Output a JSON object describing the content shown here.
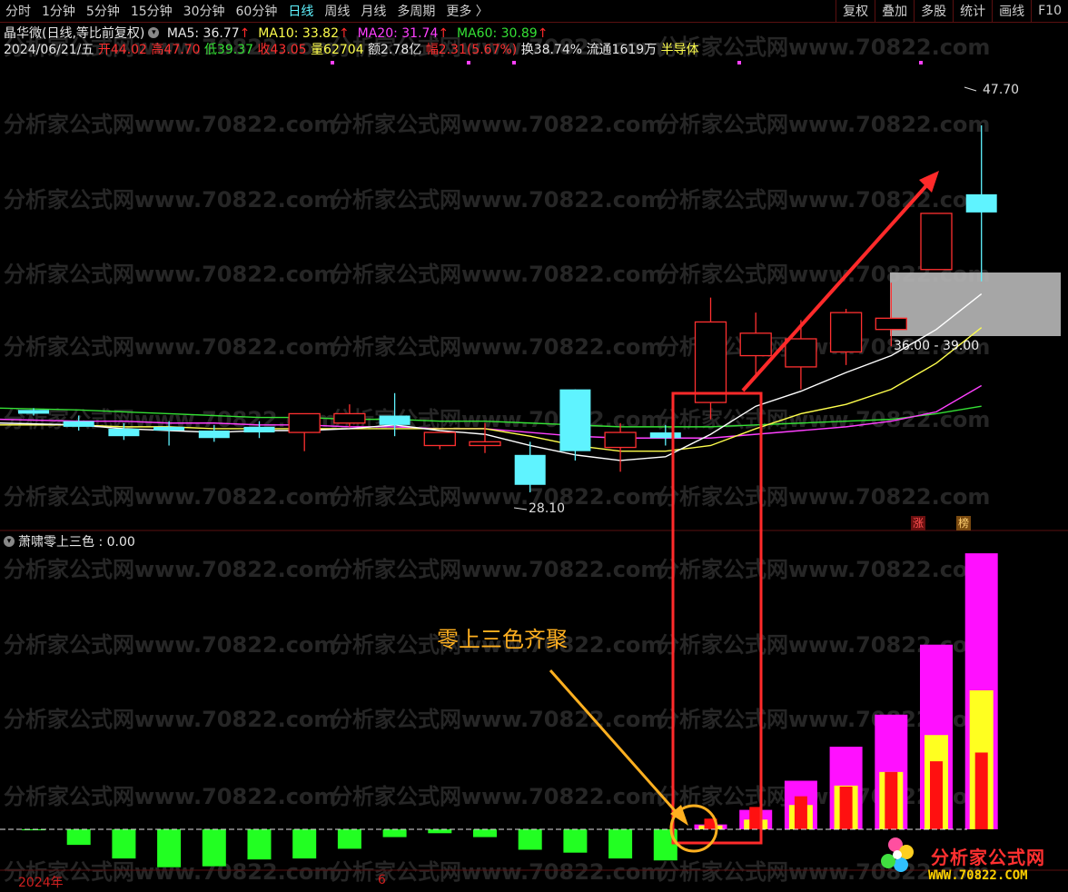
{
  "toolbar": {
    "tabs": [
      "分时",
      "1分钟",
      "5分钟",
      "15分钟",
      "30分钟",
      "60分钟",
      "日线",
      "周线",
      "月线",
      "多周期",
      "更多 〉"
    ],
    "active_tab": "日线",
    "right_buttons": [
      "复权",
      "叠加",
      "多股",
      "统计",
      "画线",
      "F10"
    ]
  },
  "title_row": {
    "title": "晶华微(日线,等比前复权)",
    "ma5": "MA5: 36.77",
    "ma10": "MA10: 33.82",
    "ma20": "MA20: 31.74",
    "ma60": "MA60: 30.89",
    "up_arrow": "↑"
  },
  "info_row": {
    "date": "2024/06/21/五",
    "open": "开44.02",
    "high": "高47.70",
    "low": "低39.37",
    "close": "收43.05",
    "volume": "量62704",
    "amount": "额2.78亿",
    "amplitude": "幅2.31(5.67%)",
    "turnover": "换38.74%",
    "float": "流通1619万",
    "sector": "半导体"
  },
  "price_labels": {
    "high_label": "47.70",
    "low_label": "28.10",
    "zone_label": "36.00 - 39.00"
  },
  "badges": {
    "zhang": "涨",
    "bang": "榜"
  },
  "indicator": {
    "name": "萧啸零上三色 : 0.00"
  },
  "annotation": {
    "text": "零上三色齐聚"
  },
  "axis": {
    "year": "2024年",
    "month": "6"
  },
  "watermark": "分析家公式网www.70822.com",
  "logo": {
    "name": "分析家公式网",
    "url": "WWW.70822.COM"
  },
  "colors": {
    "up": "#ff3030",
    "down": "#5ff3ff",
    "ma5": "#ffffff",
    "ma10": "#ffff4d",
    "ma20": "#ff40ff",
    "ma60": "#35e035",
    "bar_green": "#22ff22",
    "bar_magenta": "#ff10ff",
    "bar_yellow": "#ffff20",
    "bar_red": "#ff1010",
    "annotation": "#ffb020"
  },
  "chart_data": {
    "type": "candlestick",
    "price_range": [
      26.5,
      51.0
    ],
    "candles": [
      {
        "o": 32.5,
        "h": 32.6,
        "c": 32.3,
        "l": 32.2
      },
      {
        "o": 31.9,
        "h": 32.2,
        "c": 31.6,
        "l": 31.4
      },
      {
        "o": 31.5,
        "h": 31.8,
        "c": 31.1,
        "l": 30.9
      },
      {
        "o": 31.6,
        "h": 31.9,
        "c": 31.4,
        "l": 30.6
      },
      {
        "o": 31.4,
        "h": 31.7,
        "c": 31.0,
        "l": 30.8
      },
      {
        "o": 31.6,
        "h": 31.9,
        "c": 31.3,
        "l": 31.0
      },
      {
        "o": 31.3,
        "h": 32.3,
        "c": 32.3,
        "l": 30.3
      },
      {
        "o": 31.8,
        "h": 32.8,
        "c": 32.3,
        "l": 31.6
      },
      {
        "o": 32.2,
        "h": 33.4,
        "c": 31.7,
        "l": 31.1
      },
      {
        "o": 30.6,
        "h": 31.2,
        "c": 31.3,
        "l": 30.4
      },
      {
        "o": 30.6,
        "h": 31.8,
        "c": 30.8,
        "l": 30.2
      },
      {
        "o": 30.1,
        "h": 30.8,
        "c": 28.5,
        "l": 28.1
      },
      {
        "o": 33.6,
        "h": 33.6,
        "c": 30.3,
        "l": 29.8
      },
      {
        "o": 30.5,
        "h": 31.8,
        "c": 31.3,
        "l": 29.2
      },
      {
        "o": 31.3,
        "h": 31.7,
        "c": 31.0,
        "l": 30.6
      },
      {
        "o": 32.9,
        "h": 38.5,
        "c": 37.2,
        "l": 32.0
      },
      {
        "o": 35.4,
        "h": 37.7,
        "c": 36.6,
        "l": 34.4
      },
      {
        "o": 34.8,
        "h": 37.3,
        "c": 36.3,
        "l": 33.6
      },
      {
        "o": 35.6,
        "h": 37.9,
        "c": 37.7,
        "l": 34.9
      },
      {
        "o": 36.8,
        "h": 39.3,
        "c": 37.4,
        "l": 35.9
      },
      {
        "o": 40.0,
        "h": 43.0,
        "c": 43.0,
        "l": 40.0
      },
      {
        "o": 44.02,
        "h": 47.7,
        "c": 43.05,
        "l": 39.37
      }
    ],
    "ma5": [
      31.8,
      31.7,
      31.5,
      31.4,
      31.3,
      31.4,
      31.4,
      31.5,
      31.7,
      31.4,
      31.2,
      30.6,
      30.1,
      29.8,
      30.0,
      31.2,
      32.7,
      33.5,
      34.5,
      35.4,
      36.8,
      38.7
    ],
    "ma10": [
      31.7,
      31.7,
      31.6,
      31.6,
      31.5,
      31.5,
      31.5,
      31.5,
      31.5,
      31.5,
      31.5,
      31.1,
      30.6,
      30.3,
      30.3,
      30.6,
      31.5,
      32.3,
      32.8,
      33.6,
      35.0,
      36.9
    ],
    "ma20": [
      32.0,
      31.9,
      31.9,
      31.8,
      31.8,
      31.7,
      31.7,
      31.6,
      31.6,
      31.5,
      31.5,
      31.3,
      31.1,
      31.0,
      31.0,
      31.0,
      31.2,
      31.4,
      31.6,
      31.9,
      32.4,
      33.8
    ],
    "ma60": [
      32.6,
      32.5,
      32.4,
      32.3,
      32.2,
      32.1,
      32.1,
      32.0,
      32.0,
      31.9,
      31.9,
      31.8,
      31.7,
      31.6,
      31.6,
      31.6,
      31.7,
      31.8,
      31.9,
      32.0,
      32.3,
      32.7
    ],
    "indicator": {
      "green": [
        -0.01,
        -0.16,
        -0.3,
        -0.39,
        -0.38,
        -0.31,
        -0.3,
        -0.2,
        -0.08,
        -0.04,
        -0.08,
        -0.21,
        -0.24,
        -0.3,
        -0.32,
        0,
        0,
        0,
        0,
        0,
        0,
        0
      ],
      "magenta": [
        0,
        0,
        0,
        0,
        0,
        0,
        0,
        0,
        0,
        0,
        0,
        0,
        0,
        0,
        0,
        0.05,
        0.2,
        0.5,
        0.85,
        1.18,
        1.9,
        2.84
      ],
      "yellow": [
        0,
        0,
        0,
        0,
        0,
        0,
        0,
        0,
        0,
        0,
        0,
        0,
        0,
        0,
        0,
        0.04,
        0.1,
        0.25,
        0.45,
        0.59,
        0.97,
        1.43
      ],
      "red": [
        0,
        0,
        0,
        0,
        0,
        0,
        0,
        0,
        0,
        0,
        0,
        0,
        0,
        0,
        0,
        0.11,
        0.23,
        0.34,
        0.44,
        0.59,
        0.7,
        0.79
      ]
    }
  }
}
